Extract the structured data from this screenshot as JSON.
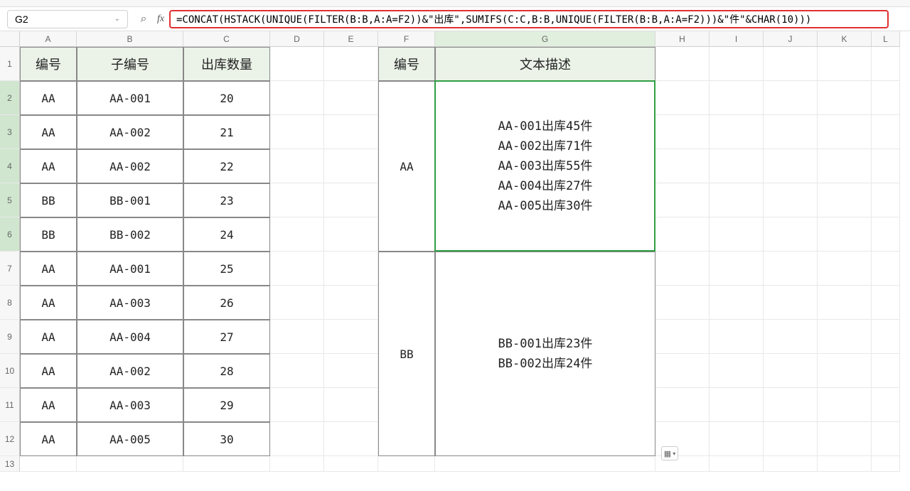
{
  "nameBox": {
    "value": "G2"
  },
  "formulaBar": {
    "fxLabel": "fx",
    "formula": "=CONCAT(HSTACK(UNIQUE(FILTER(B:B,A:A=F2))&\"出库\",SUMIFS(C:C,B:B,UNIQUE(FILTER(B:B,A:A=F2)))&\"件\"&CHAR(10)))"
  },
  "columns": [
    "A",
    "B",
    "C",
    "D",
    "E",
    "F",
    "G",
    "H",
    "I",
    "J",
    "K",
    "L"
  ],
  "rows": [
    "1",
    "2",
    "3",
    "4",
    "5",
    "6",
    "7",
    "8",
    "9",
    "10",
    "11",
    "12",
    "13"
  ],
  "tableLeft": {
    "headers": {
      "A": "编号",
      "B": "子编号",
      "C": "出库数量"
    },
    "data": [
      {
        "A": "AA",
        "B": "AA-001",
        "C": "20"
      },
      {
        "A": "AA",
        "B": "AA-002",
        "C": "21"
      },
      {
        "A": "AA",
        "B": "AA-002",
        "C": "22"
      },
      {
        "A": "BB",
        "B": "BB-001",
        "C": "23"
      },
      {
        "A": "BB",
        "B": "BB-002",
        "C": "24"
      },
      {
        "A": "AA",
        "B": "AA-001",
        "C": "25"
      },
      {
        "A": "AA",
        "B": "AA-003",
        "C": "26"
      },
      {
        "A": "AA",
        "B": "AA-004",
        "C": "27"
      },
      {
        "A": "AA",
        "B": "AA-002",
        "C": "28"
      },
      {
        "A": "AA",
        "B": "AA-003",
        "C": "29"
      },
      {
        "A": "AA",
        "B": "AA-005",
        "C": "30"
      }
    ]
  },
  "tableRight": {
    "headers": {
      "F": "编号",
      "G": "文本描述"
    },
    "rows": [
      {
        "F": "AA",
        "G": "AA-001出库45件\nAA-002出库71件\nAA-003出库55件\nAA-004出库27件\nAA-005出库30件"
      },
      {
        "F": "BB",
        "G": "BB-001出库23件\nBB-002出库24件"
      }
    ]
  },
  "icons": {
    "zoomOut": "⌕",
    "chevron": "⌄",
    "quickAnalysis": "▦"
  }
}
